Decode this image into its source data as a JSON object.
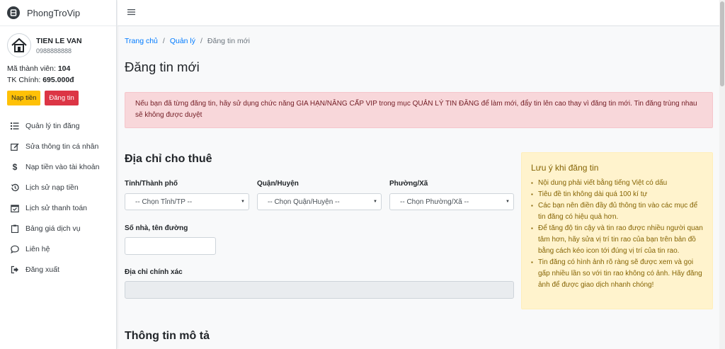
{
  "brand": {
    "name": "PhongTroVip"
  },
  "user": {
    "name": "TIEN LE VAN",
    "phone": "0988888888",
    "member_label": "Mã thành viên:",
    "member_id": "104",
    "balance_label": "TK Chính:",
    "balance": "695.000đ",
    "deposit_btn": "Nạp tiền",
    "post_btn": "Đăng tin"
  },
  "menu": [
    {
      "label": "Quản lý tin đăng",
      "icon": "list-icon"
    },
    {
      "label": "Sửa thông tin cá nhân",
      "icon": "edit-icon"
    },
    {
      "label": "Nạp tiền vào tài khoản",
      "icon": "dollar-icon"
    },
    {
      "label": "Lịch sử nạp tiền",
      "icon": "history-icon"
    },
    {
      "label": "Lịch sử thanh toán",
      "icon": "calendar-check-icon"
    },
    {
      "label": "Bảng giá dịch vụ",
      "icon": "clipboard-icon"
    },
    {
      "label": "Liên hệ",
      "icon": "chat-icon"
    },
    {
      "label": "Đăng xuất",
      "icon": "logout-icon"
    }
  ],
  "breadcrumb": {
    "home": "Trang chủ",
    "manage": "Quản lý",
    "current": "Đăng tin mới",
    "separator": "/"
  },
  "page_title": "Đăng tin mới",
  "alert": "Nếu bạn đã từng đăng tin, hãy sử dụng chức năng GIA HẠN/NÂNG CẤP VIP trong mục QUẢN LÝ TIN ĐĂNG để làm mới, đẩy tin lên cao thay vì đăng tin mới. Tin đăng trùng nhau sẽ không được duyệt",
  "address": {
    "section_title": "Địa chỉ cho thuê",
    "province_label": "Tỉnh/Thành phố",
    "province_value": "-- Chọn Tỉnh/TP --",
    "district_label": "Quận/Huyện",
    "district_value": "-- Chọn Quận/Huyện --",
    "ward_label": "Phường/Xã",
    "ward_value": "-- Chọn Phường/Xã --",
    "street_label": "Số nhà, tên đường",
    "street_value": "",
    "exact_label": "Địa chỉ chính xác",
    "exact_value": ""
  },
  "description": {
    "section_title": "Thông tin mô tả"
  },
  "note": {
    "title": "Lưu ý khi đăng tin",
    "items": [
      "Nội dung phải viết bằng tiếng Việt có dấu",
      "Tiêu đề tin không dài quá 100 kí tự",
      "Các bạn nên điền đầy đủ thông tin vào các mục để tin đăng có hiệu quả hơn.",
      "Để tăng độ tin cậy và tin rao được nhiều người quan tâm hơn, hãy sửa vị trí tin rao của bạn trên bản đồ bằng cách kéo icon tới đúng vị trí của tin rao.",
      "Tin đăng có hình ảnh rõ ràng sẽ được xem và gọi gấp nhiều lần so với tin rao không có ảnh. Hãy đăng ảnh để được giao dịch nhanh chóng!"
    ]
  }
}
